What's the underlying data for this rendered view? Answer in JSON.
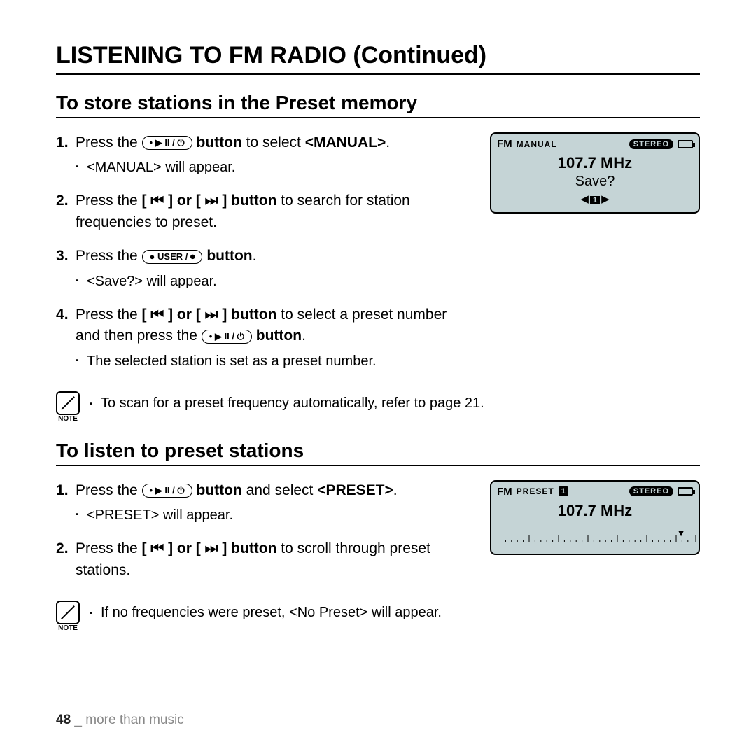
{
  "title": "LISTENING TO FM RADIO (Continued)",
  "section1": {
    "heading": "To store stations in the Preset memory",
    "steps": {
      "s1a": "Press the ",
      "s1b": " button",
      "s1c": " to select ",
      "s1d": "<MANUAL>",
      "s1e": ".",
      "s1sub": "<MANUAL> will appear.",
      "s2a": "Press the ",
      "s2b": "[ ⏮ ] or [ ⏭ ] button",
      "s2c": " to search for station frequencies to preset.",
      "s3a": "Press the ",
      "s3b": " button",
      "s3c": ".",
      "s3sub": "<Save?> will appear.",
      "s4a": "Press the ",
      "s4b": "[ ⏮ ] or [ ⏭ ] button",
      "s4c": " to select a preset number and then press the ",
      "s4d": " button",
      "s4e": ".",
      "s4sub": "The selected station is set as a preset number."
    },
    "note": "To scan for a preset frequency automatically, refer to page 21.",
    "screen": {
      "fm": "FM",
      "mode": "MANUAL",
      "stereo": "STEREO",
      "freq": "107.7 MHz",
      "save": "Save?",
      "navnum": "1"
    }
  },
  "section2": {
    "heading": "To listen to preset stations",
    "steps": {
      "s1a": "Press the ",
      "s1b": " button",
      "s1c": " and select ",
      "s1d": "<PRESET>",
      "s1e": ".",
      "s1sub": "<PRESET> will appear.",
      "s2a": "Press the ",
      "s2b": "[ ⏮ ] or [ ⏭ ] button",
      "s2c": " to scroll through preset stations."
    },
    "note": "If no frequencies were preset, <No Preset> will appear.",
    "screen": {
      "fm": "FM",
      "mode": "PRESET",
      "preset_num": "1",
      "stereo": "STEREO",
      "freq": "107.7 MHz"
    }
  },
  "buttons": {
    "play": "• ▶ II / ⏻",
    "user": "● USER / ⏺"
  },
  "note_label": "NOTE",
  "footer": {
    "page": "48",
    "sep": " _ ",
    "text": "more than music"
  }
}
